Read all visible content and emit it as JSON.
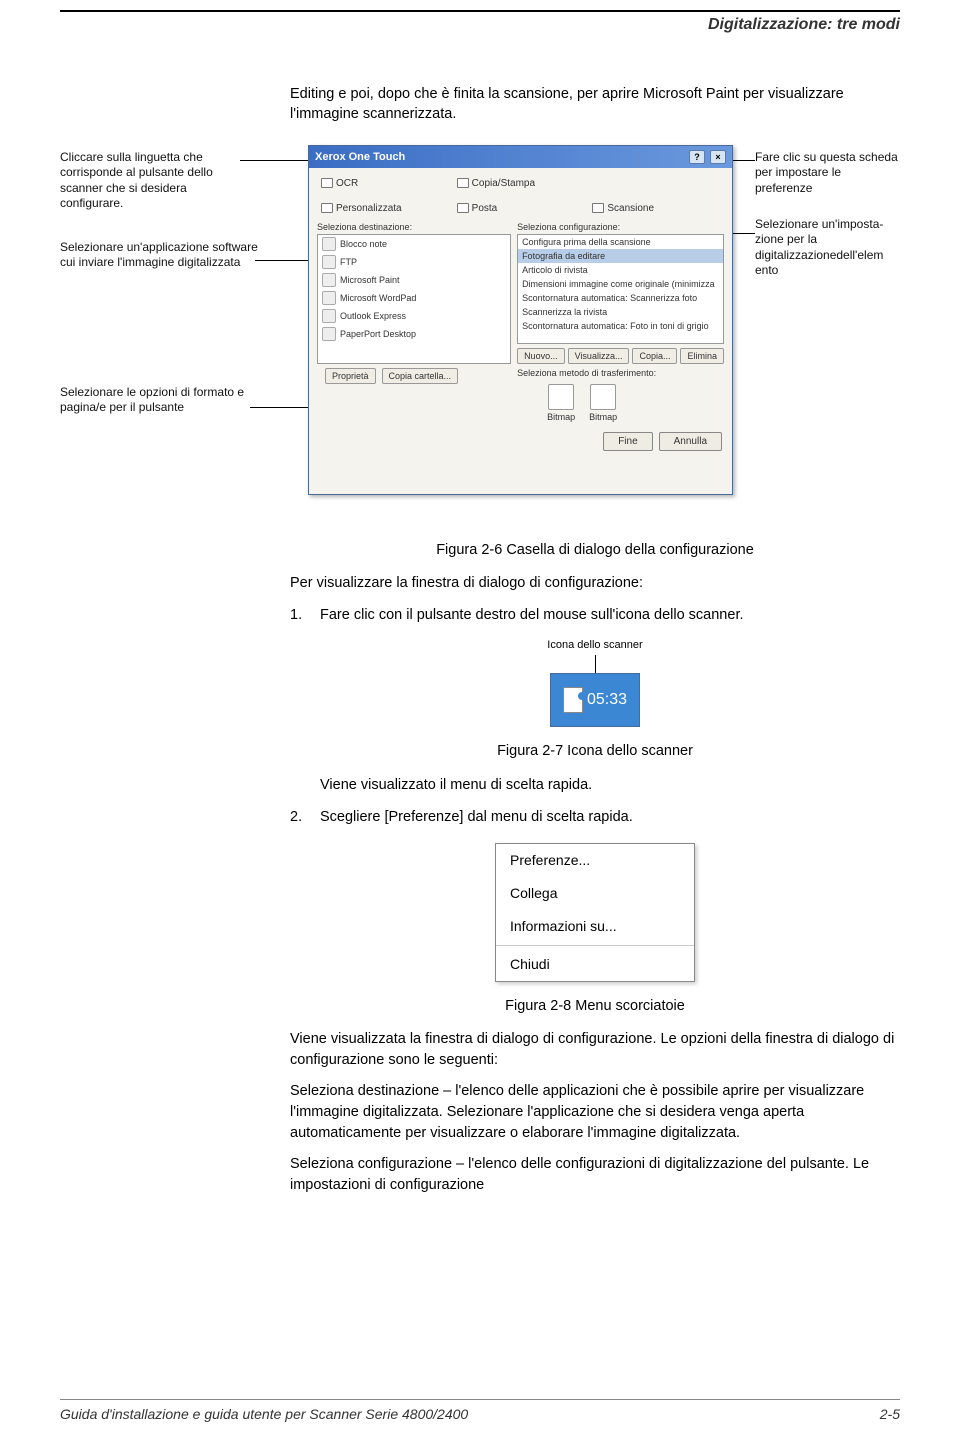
{
  "header": {
    "section_title": "Digitalizzazione: tre modi"
  },
  "intro": "Editing e poi, dopo che è finita la scansione, per aprire Microsoft Paint per visualizzare l'immagine scannerizzata.",
  "callouts": {
    "left1": "Cliccare sulla linguetta che corrisponde al pulsante dello scanner che si desidera configurare.",
    "left2": "Selezionare un'applicazione software cui inviare l'immagine digitalizzata",
    "left3": "Selezionare le opzioni di formato e pagina/e per il pulsante",
    "right1": "Fare clic su questa scheda per impostare le preferenze",
    "right2": "Selezionare un'imposta-zione per la digitalizzazionedell'elem ento"
  },
  "dialog": {
    "title": "Xerox One Touch",
    "tabs": {
      "ocr": "OCR",
      "copia": "Copia/Stampa",
      "personalizzata": "Personalizzata",
      "posta": "Posta",
      "scansione": "Scansione"
    },
    "labels": {
      "seleziona_dest": "Seleziona destinazione:",
      "seleziona_conf": "Seleziona configurazione:",
      "seleziona_metodo": "Seleziona metodo di trasferimento:"
    },
    "apps": [
      "Blocco note",
      "FTP",
      "Microsoft Paint",
      "Microsoft WordPad",
      "Outlook Express",
      "PaperPort Desktop"
    ],
    "configs": [
      "Configura prima della scansione",
      "Fotografia da editare",
      "Articolo di rivista",
      "Dimensioni immagine come originale (minimizza",
      "Scontornatura automatica: Scannerizza foto",
      "Scannerizza la rivista",
      "Scontornatura automatica: Foto in toni di grigio"
    ],
    "mini": {
      "nuovo": "Nuovo...",
      "visualizza": "Visualizza...",
      "copia": "Copia...",
      "elimina": "Elimina"
    },
    "transfer": {
      "bitmap1": "Bitmap",
      "bitmap2": "Bitmap"
    },
    "prop": {
      "proprieta": "Proprietà",
      "copia_cartella": "Copia cartella..."
    },
    "buttons": {
      "fine": "Fine",
      "annulla": "Annulla"
    }
  },
  "figures": {
    "f26": "Figura 2-6 Casella di dialogo della configurazione",
    "f27": "Figura 2-7 Icona dello scanner",
    "f28": "Figura 2-8 Menu scorciatoie"
  },
  "body": {
    "per_visualizzare": "Per visualizzare la finestra di dialogo di configurazione:",
    "step1": "Fare clic con il pulsante destro del mouse sull'icona dello scanner.",
    "icon_label": "Icona dello scanner",
    "clock": "05:33",
    "viene_menu": "Viene visualizzato il menu di scelta rapida.",
    "step2": "Scegliere [Preferenze] dal menu di scelta rapida.",
    "menu": {
      "pref": "Preferenze...",
      "collega": "Collega",
      "info": "Informazioni su...",
      "chiudi": "Chiudi"
    },
    "p2": "Viene visualizzata la finestra di dialogo di configurazione. Le opzioni della finestra di dialogo di configurazione sono le seguenti:",
    "p3": "Seleziona destinazione – l'elenco delle applicazioni che è possibile aprire per visualizzare l'immagine digitalizzata. Selezionare l'applicazione che si desidera venga aperta automaticamente per visualizzare o elaborare l'immagine digitalizzata.",
    "p4": "Seleziona configurazione – l'elenco delle configurazioni di digitalizzazione del pulsante. Le impostazioni di configurazione"
  },
  "footer": {
    "left": "Guida d'installazione e guida utente per Scanner Serie 4800/2400",
    "right": "2-5"
  }
}
